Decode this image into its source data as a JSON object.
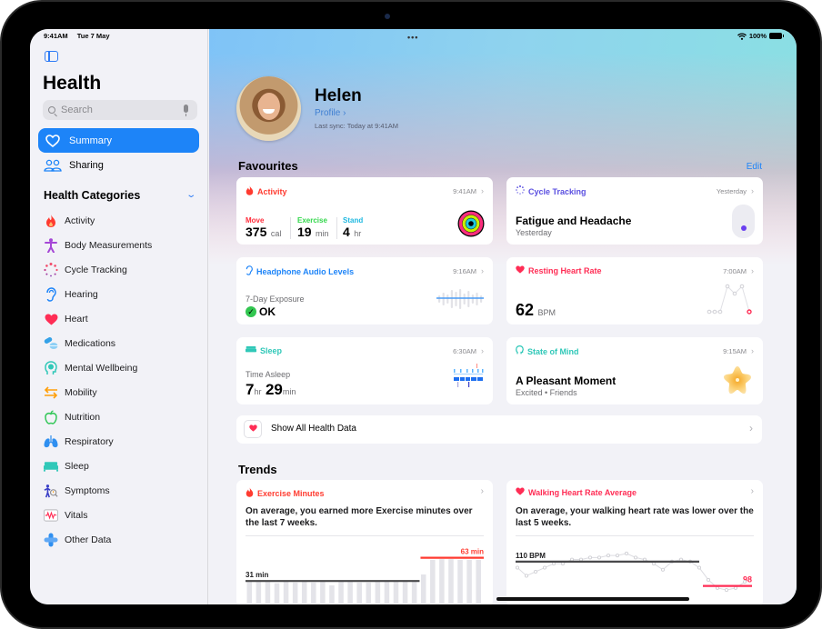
{
  "status_bar": {
    "time": "9:41AM",
    "date": "Tue 7 May",
    "battery": "100%"
  },
  "sidebar": {
    "title": "Health",
    "search_placeholder": "Search",
    "nav": [
      {
        "label": "Summary",
        "icon": "heart-outline-icon",
        "active": true
      },
      {
        "label": "Sharing",
        "icon": "people-icon",
        "active": false
      }
    ],
    "categories_header": "Health Categories",
    "categories": [
      {
        "label": "Activity",
        "icon": "flame-icon",
        "color": "#ff3b30"
      },
      {
        "label": "Body Measurements",
        "icon": "figure-icon",
        "color": "#a547d6"
      },
      {
        "label": "Cycle Tracking",
        "icon": "cycle-dots-icon",
        "color": "#f24b6a"
      },
      {
        "label": "Hearing",
        "icon": "ear-icon",
        "color": "#1d84f8"
      },
      {
        "label": "Heart",
        "icon": "heart-icon",
        "color": "#ff2d55"
      },
      {
        "label": "Medications",
        "icon": "pills-icon",
        "color": "#35a2e8"
      },
      {
        "label": "Mental Wellbeing",
        "icon": "head-icon",
        "color": "#30c8b8"
      },
      {
        "label": "Mobility",
        "icon": "arrows-icon",
        "color": "#ff9f0a"
      },
      {
        "label": "Nutrition",
        "icon": "apple-icon",
        "color": "#34c759"
      },
      {
        "label": "Respiratory",
        "icon": "lungs-icon",
        "color": "#2f8ff0"
      },
      {
        "label": "Sleep",
        "icon": "bed-icon",
        "color": "#30c8b8"
      },
      {
        "label": "Symptoms",
        "icon": "symptoms-icon",
        "color": "#3a3fc7"
      },
      {
        "label": "Vitals",
        "icon": "vitals-icon",
        "color": "#ff2d55"
      },
      {
        "label": "Other Data",
        "icon": "plus-icon",
        "color": "#2f8ff0"
      }
    ]
  },
  "profile": {
    "name": "Helen",
    "link": "Profile",
    "last_sync": "Last sync: Today at 9:41AM"
  },
  "favourites": {
    "title": "Favourites",
    "edit": "Edit",
    "activity": {
      "title": "Activity",
      "time": "9:41AM",
      "move_label": "Move",
      "move_value": "375",
      "move_unit": "cal",
      "exercise_label": "Exercise",
      "exercise_value": "19",
      "exercise_unit": "min",
      "stand_label": "Stand",
      "stand_value": "4",
      "stand_unit": "hr"
    },
    "cycle": {
      "title": "Cycle Tracking",
      "time": "Yesterday",
      "value": "Fatigue and Headache",
      "sub": "Yesterday"
    },
    "headphone": {
      "title": "Headphone Audio Levels",
      "time": "9:16AM",
      "label": "7-Day Exposure",
      "value": "OK"
    },
    "resting": {
      "title": "Resting Heart Rate",
      "time": "7:00AM",
      "value": "62",
      "unit": "BPM"
    },
    "sleep": {
      "title": "Sleep",
      "time": "6:30AM",
      "label": "Time Asleep",
      "hours": "7",
      "hr_unit": "hr",
      "minutes": "29",
      "min_unit": "min"
    },
    "mind": {
      "title": "State of Mind",
      "time": "9:15AM",
      "value": "A Pleasant Moment",
      "sub": "Excited • Friends"
    }
  },
  "show_all": "Show All Health Data",
  "trends": {
    "title": "Trends",
    "exercise": {
      "title": "Exercise Minutes",
      "desc": "On average, you earned more Exercise minutes over the last 7 weeks.",
      "old_avg_label": "31 min",
      "new_avg_label": "63 min",
      "old_avg": 31,
      "new_avg": 63,
      "bars": [
        30,
        30,
        30,
        28,
        30,
        29,
        30,
        29,
        30,
        25,
        30,
        30,
        29,
        29,
        30,
        30,
        30,
        30,
        30,
        40,
        60,
        61,
        61,
        60,
        60,
        60
      ]
    },
    "walking": {
      "title": "Walking Heart Rate Average",
      "desc": "On average, your walking heart rate was lower over the last 5 weeks.",
      "old_avg_label": "110 BPM",
      "new_avg_label": "98",
      "old_avg": 110,
      "new_avg": 98,
      "points": [
        107,
        103,
        105,
        107,
        109,
        109,
        111,
        111,
        112,
        112,
        113,
        113,
        114,
        112,
        111,
        109,
        106,
        110,
        111,
        110,
        107,
        101,
        97,
        96,
        97,
        100
      ]
    }
  },
  "colors": {
    "accent": "#1d84f8",
    "activity": "#ff3b30",
    "heart": "#ff2d55",
    "cycle": "#5a4fe0",
    "sleep": "#30c8b8"
  }
}
